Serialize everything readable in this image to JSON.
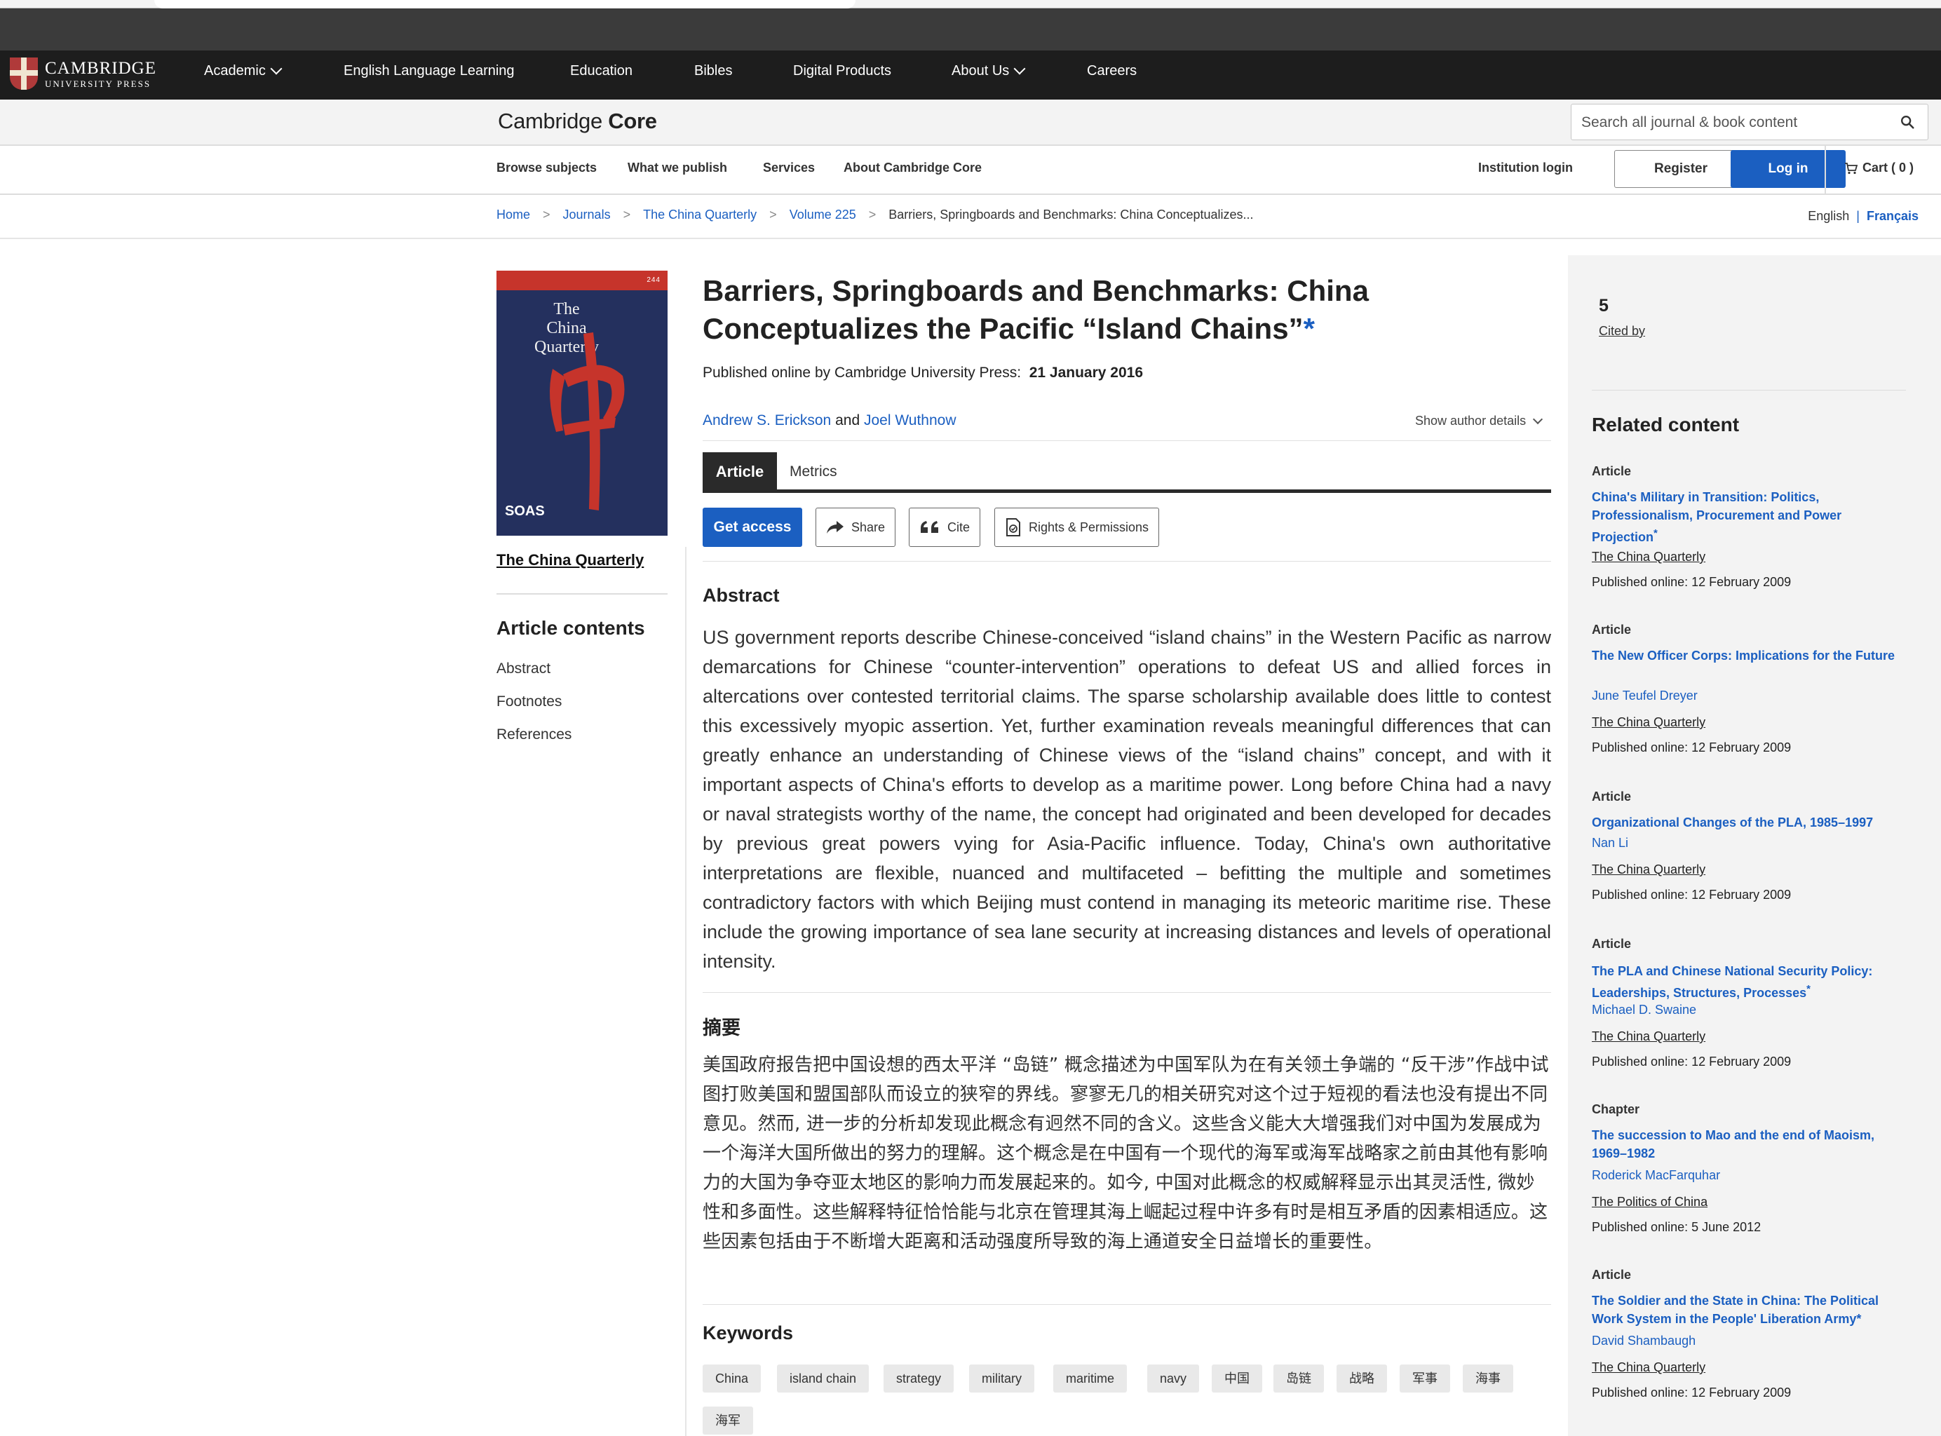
{
  "global_nav": {
    "logo_top": "Cambridge",
    "logo_bottom": "UNIVERSITY PRESS",
    "items": [
      "Academic",
      "English Language Learning",
      "Education",
      "Bibles",
      "Digital Products",
      "About Us",
      "Careers"
    ]
  },
  "core": {
    "logo_part1": "Cambridge",
    "logo_part2": "Core",
    "search_placeholder": "Search all journal & book content"
  },
  "subnav": {
    "items": [
      "Browse subjects",
      "What we publish",
      "Services",
      "About Cambridge Core"
    ],
    "institution_login": "Institution login",
    "register": "Register",
    "login": "Log in",
    "cart": "Cart ( 0 )"
  },
  "breadcrumbs": [
    "Home",
    "Journals",
    "The China Quarterly",
    "Volume 225",
    "Barriers, Springboards and Benchmarks: China Conceptualizes..."
  ],
  "language": {
    "current": "English",
    "other": "Français"
  },
  "journal": {
    "cover_title_1": "The",
    "cover_title_2": "China",
    "cover_title_3": "Quarterly",
    "cover_issue": "244",
    "cover_publisher": "SOAS",
    "caption": "The China Quarterly"
  },
  "contents": {
    "heading": "Article contents",
    "items": [
      "Abstract",
      "Footnotes",
      "References"
    ]
  },
  "article": {
    "title": "Barriers, Springboards and Benchmarks: China Conceptualizes the Pacific “Island Chains”",
    "title_star": "*",
    "published_prefix": "Published online by Cambridge University Press:",
    "published_date": "21 January 2016",
    "author1": "Andrew S. Erickson",
    "author_join": "and",
    "author2": "Joel Wuthnow",
    "author_details": "Show author details",
    "tab_article": "Article",
    "tab_metrics": "Metrics",
    "get_access": "Get access",
    "share": "Share",
    "cite": "Cite",
    "rights": "Rights & Permissions",
    "abstract_heading": "Abstract",
    "abstract_text": "US government reports describe Chinese-conceived “island chains” in the Western Pacific as narrow demarcations for Chinese “counter-intervention” operations to defeat US and allied forces in altercations over contested territorial claims. The sparse scholarship available does little to contest this excessively myopic assertion. Yet, further examination reveals meaningful differences that can greatly enhance an understanding of Chinese views of the “island chains” concept, and with it important aspects of China's efforts to develop as a maritime power. Long before China had a navy or naval strategists worthy of the name, the concept had originated and been developed for decades by previous great powers vying for Asia-Pacific influence. Today, China's own authoritative interpretations are flexible, nuanced and multifaceted – befitting the multiple and sometimes contradictory factors with which Beijing must contend in managing its meteoric maritime rise. These include the growing importance of sea lane security at increasing distances and levels of operational intensity.",
    "abstract_zh_heading": "摘要",
    "abstract_zh_text": "美国政府报告把中国设想的西太平洋 “岛链” 概念描述为中国军队为在有关领土争端的 “反干涉”作战中试图打败美国和盟国部队而设立的狭窄的界线。寥寥无几的相关研究对这个过于短视的看法也没有提出不同意见。然而, 进一步的分析却发现此概念有迥然不同的含义。这些含义能大大增强我们对中国为发展成为一个海洋大国所做出的努力的理解。这个概念是在中国有一个现代的海军或海军战略家之前由其他有影响力的大国为争夺亚太地区的影响力而发展起来的。如今, 中国对此概念的权威解释显示出其灵活性, 微妙性和多面性。这些解释特征恰恰能与北京在管理其海上崛起过程中许多有时是相互矛盾的因素相适应。这些因素包括由于不断增大距离和活动强度所导致的海上通道安全日益增长的重要性。",
    "keywords_heading": "Keywords",
    "keywords": [
      "China",
      "island chain",
      "strategy",
      "military",
      "maritime",
      "navy",
      "中国",
      "岛链",
      "战略",
      "军事",
      "海事",
      "海军"
    ]
  },
  "sidebar": {
    "cited_count": "5",
    "cited_label": "Cited by",
    "related_heading": "Related content",
    "related": [
      {
        "type": "Article",
        "title": "China's Military in Transition: Politics, Professionalism, Procurement and Power Projection",
        "title_star": "*",
        "author": "",
        "journal": "The China Quarterly",
        "date": "Published online: 12 February 2009"
      },
      {
        "type": "Article",
        "title": "The New Officer Corps: Implications for the Future",
        "title_star": "",
        "author": "June Teufel Dreyer",
        "journal": "The China Quarterly",
        "date": "Published online: 12 February 2009"
      },
      {
        "type": "Article",
        "title": "Organizational Changes of the PLA, 1985–1997",
        "title_star": "",
        "author": "Nan Li",
        "journal": "The China Quarterly",
        "date": "Published online: 12 February 2009"
      },
      {
        "type": "Article",
        "title": "The PLA and Chinese National Security Policy: Leaderships, Structures, Processes",
        "title_star": "*",
        "author": "Michael D. Swaine",
        "journal": "The China Quarterly",
        "date": "Published online: 12 February 2009"
      },
      {
        "type": "Chapter",
        "title": "The succession to Mao and the end of Maoism, 1969–1982",
        "title_star": "",
        "author": "Roderick MacFarquhar",
        "journal": "The Politics of China",
        "date": "Published online: 5 June 2012"
      },
      {
        "type": "Article",
        "title": "The Soldier and the State in China: The Political Work System in the People' Liberation Army*",
        "title_star": "",
        "author": "David Shambaugh",
        "journal": "The China Quarterly",
        "date": "Published online: 12 February 2009"
      }
    ]
  }
}
